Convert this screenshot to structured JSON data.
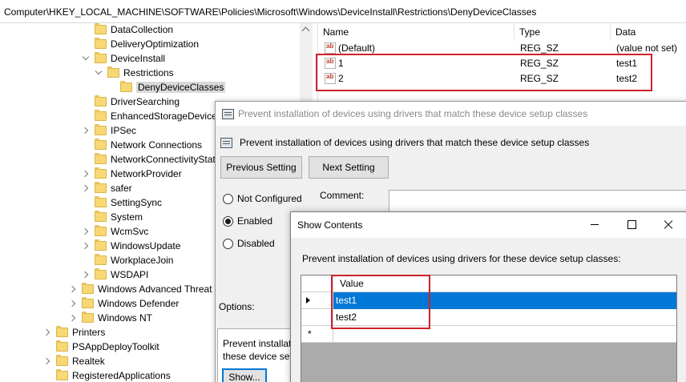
{
  "address_bar": "Computer\\HKEY_LOCAL_MACHINE\\SOFTWARE\\Policies\\Microsoft\\Windows\\DeviceInstall\\Restrictions\\DenyDeviceClasses",
  "tree": {
    "items": [
      {
        "label": "DataCollection",
        "expander": "none"
      },
      {
        "label": "DeliveryOptimization",
        "expander": "none"
      },
      {
        "label": "DeviceInstall",
        "expander": "down"
      },
      {
        "label": "Restrictions",
        "expander": "down"
      },
      {
        "label": "DenyDeviceClasses",
        "expander": "none",
        "selected": true
      },
      {
        "label": "DriverSearching",
        "expander": "none"
      },
      {
        "label": "EnhancedStorageDevices",
        "expander": "none"
      },
      {
        "label": "IPSec",
        "expander": "right"
      },
      {
        "label": "Network Connections",
        "expander": "none"
      },
      {
        "label": "NetworkConnectivityStat",
        "expander": "none"
      },
      {
        "label": "NetworkProvider",
        "expander": "right"
      },
      {
        "label": "safer",
        "expander": "right"
      },
      {
        "label": "SettingSync",
        "expander": "none"
      },
      {
        "label": "System",
        "expander": "none"
      },
      {
        "label": "WcmSvc",
        "expander": "right"
      },
      {
        "label": "WindowsUpdate",
        "expander": "right"
      },
      {
        "label": "WorkplaceJoin",
        "expander": "none"
      },
      {
        "label": "WSDAPI",
        "expander": "right"
      },
      {
        "label": "Windows Advanced Threat P",
        "expander": "right"
      },
      {
        "label": "Windows Defender",
        "expander": "right"
      },
      {
        "label": "Windows NT",
        "expander": "right"
      },
      {
        "label": "Printers",
        "expander": "right"
      },
      {
        "label": "PSAppDeployToolkit",
        "expander": "none"
      },
      {
        "label": "Realtek",
        "expander": "right"
      },
      {
        "label": "RegisteredApplications",
        "expander": "none"
      }
    ]
  },
  "values": {
    "headers": [
      "Name",
      "Type",
      "Data"
    ],
    "rows": [
      {
        "icon": "string-value-icon",
        "name": "(Default)",
        "type": "REG_SZ",
        "data": "(value not set)"
      },
      {
        "icon": "string-value-icon",
        "name": "1",
        "type": "REG_SZ",
        "data": "test1"
      },
      {
        "icon": "string-value-icon",
        "name": "2",
        "type": "REG_SZ",
        "data": "test2"
      }
    ],
    "icon_text": "ab"
  },
  "policy": {
    "window_title": "Prevent installation of devices using drivers that match these device setup classes",
    "heading": "Prevent installation of devices using drivers that match these device setup classes",
    "previous_button": "Previous Setting",
    "next_button": "Next Setting",
    "radios": [
      {
        "label": "Not Configured",
        "checked": false
      },
      {
        "label": "Enabled",
        "checked": true
      },
      {
        "label": "Disabled",
        "checked": false
      }
    ],
    "comment_label": "Comment:",
    "options_label": "Options:",
    "options_text_line1": "Prevent installati",
    "options_text_line2": "these device set",
    "show_button": "Show..."
  },
  "show_contents": {
    "title": "Show Contents",
    "description": "Prevent installation of devices using drivers for these device setup classes:",
    "column_header": "Value",
    "rows": [
      "test1",
      "test2",
      ""
    ],
    "new_row_marker": "*"
  },
  "colors": {
    "selection_blue": "#0078d7",
    "highlight_red": "#d0212b",
    "folder_yellow": "#f8d775"
  }
}
